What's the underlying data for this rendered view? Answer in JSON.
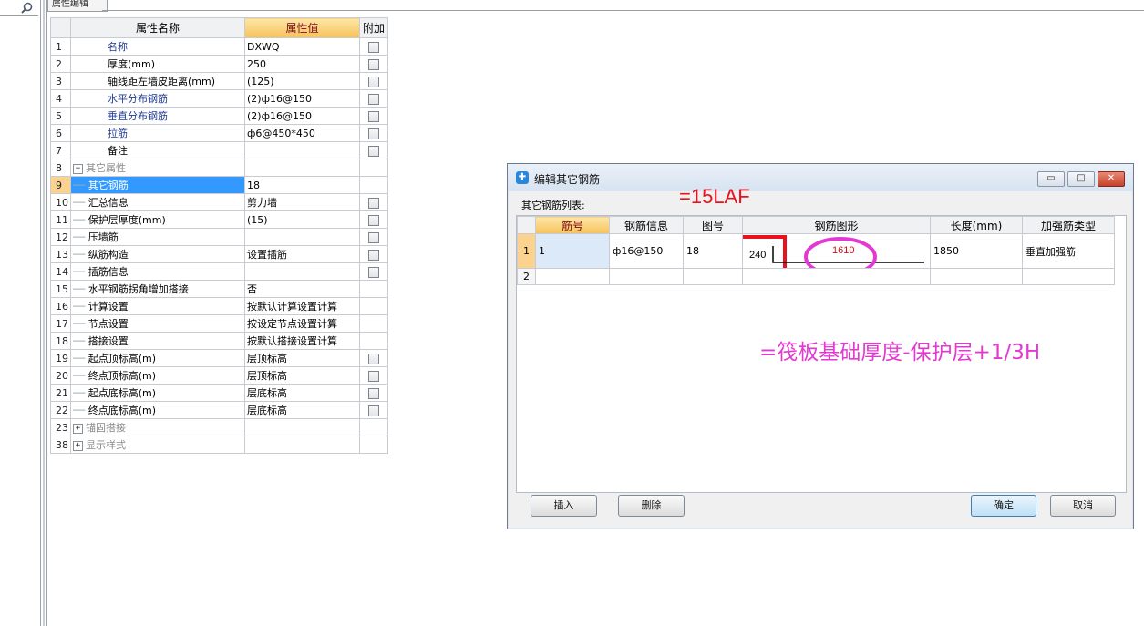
{
  "panel_tab": {
    "label": "属性编辑"
  },
  "property_grid": {
    "headers": {
      "name": "属性名称",
      "value": "属性值",
      "extra": "附加"
    },
    "rows": [
      {
        "num": "1",
        "name": "名称",
        "value": "DXWQ",
        "style": "link",
        "level": 0,
        "check": false
      },
      {
        "num": "2",
        "name": "厚度(mm)",
        "value": "250",
        "style": "plain",
        "level": 0,
        "check": true
      },
      {
        "num": "3",
        "name": "轴线距左墙皮距离(mm)",
        "value": "(125)",
        "style": "plain",
        "level": 0,
        "check": true
      },
      {
        "num": "4",
        "name": "水平分布钢筋",
        "value": "(2)ф16@150",
        "style": "link",
        "level": 0,
        "check": true
      },
      {
        "num": "5",
        "name": "垂直分布钢筋",
        "value": "(2)ф16@150",
        "style": "link",
        "level": 0,
        "check": true
      },
      {
        "num": "6",
        "name": "拉筋",
        "value": "ф6@450*450",
        "style": "link",
        "level": 0,
        "check": true
      },
      {
        "num": "7",
        "name": "备注",
        "value": "",
        "style": "plain",
        "level": 0,
        "check": true
      },
      {
        "num": "8",
        "name": "其它属性",
        "value": "",
        "style": "group",
        "expander": "−",
        "level": 0,
        "check": null
      },
      {
        "num": "9",
        "name": "其它钢筋",
        "value": "18",
        "style": "plain",
        "level": 1,
        "check": null,
        "selected": true
      },
      {
        "num": "10",
        "name": "汇总信息",
        "value": "剪力墙",
        "style": "plain",
        "level": 1,
        "check": true
      },
      {
        "num": "11",
        "name": "保护层厚度(mm)",
        "value": "(15)",
        "style": "plain",
        "level": 1,
        "check": true
      },
      {
        "num": "12",
        "name": "压墙筋",
        "value": "",
        "style": "plain",
        "level": 1,
        "check": true
      },
      {
        "num": "13",
        "name": "纵筋构造",
        "value": "设置插筋",
        "style": "plain",
        "level": 1,
        "check": true
      },
      {
        "num": "14",
        "name": "插筋信息",
        "value": "",
        "style": "plain",
        "level": 1,
        "check": true
      },
      {
        "num": "15",
        "name": "水平钢筋拐角增加搭接",
        "value": "否",
        "style": "plain",
        "level": 1,
        "check": null
      },
      {
        "num": "16",
        "name": "计算设置",
        "value": "按默认计算设置计算",
        "style": "plain",
        "level": 1,
        "check": null
      },
      {
        "num": "17",
        "name": "节点设置",
        "value": "按设定节点设置计算",
        "style": "plain",
        "level": 1,
        "check": null
      },
      {
        "num": "18",
        "name": "搭接设置",
        "value": "按默认搭接设置计算",
        "style": "plain",
        "level": 1,
        "check": null
      },
      {
        "num": "19",
        "name": "起点顶标高(m)",
        "value": "层顶标高",
        "style": "plain",
        "level": 1,
        "check": true
      },
      {
        "num": "20",
        "name": "终点顶标高(m)",
        "value": "层顶标高",
        "style": "plain",
        "level": 1,
        "check": true
      },
      {
        "num": "21",
        "name": "起点底标高(m)",
        "value": "层底标高",
        "style": "plain",
        "level": 1,
        "check": true
      },
      {
        "num": "22",
        "name": "终点底标高(m)",
        "value": "层底标高",
        "style": "plain",
        "level": 1,
        "check": true
      },
      {
        "num": "23",
        "name": "锚固搭接",
        "value": "",
        "style": "group",
        "expander": "+",
        "level": 0,
        "check": null
      },
      {
        "num": "38",
        "name": "显示样式",
        "value": "",
        "style": "group",
        "expander": "+",
        "level": 0,
        "check": null
      }
    ]
  },
  "dialog": {
    "title": "编辑其它钢筋",
    "title_icon": "app-icon",
    "window_buttons": {
      "minimize": "▭",
      "maximize": "□",
      "close": "✕"
    },
    "list_label": "其它钢筋列表:",
    "annotation_top": "=15LAF",
    "columns": [
      "筋号",
      "钢筋信息",
      "图号",
      "钢筋图形",
      "长度(mm)",
      "加强筋类型"
    ],
    "rows": [
      {
        "num": "1",
        "bar_no": "1",
        "bar_info": "ф16@150",
        "shape_no": "18",
        "dim_vertical": "240",
        "dim_horizontal": "1610",
        "length": "1850",
        "type": "垂直加强筋"
      },
      {
        "num": "2",
        "bar_no": "",
        "bar_info": "",
        "shape_no": "",
        "dim_vertical": "",
        "dim_horizontal": "",
        "length": "",
        "type": ""
      }
    ],
    "annotation_formula": "=筏板基础厚度-保护层+1/3H",
    "buttons": {
      "insert": "插入",
      "delete": "删除",
      "ok": "确定",
      "cancel": "取消"
    }
  },
  "colors": {
    "selection_blue": "#3399ff",
    "header_orange": "#f6c25a",
    "annotation_red": "#e8121f",
    "annotation_magenta": "#e23ad0"
  }
}
